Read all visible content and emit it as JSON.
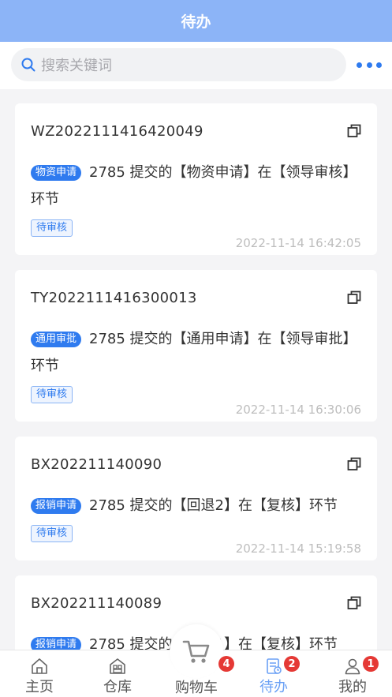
{
  "header": {
    "title": "待办"
  },
  "search": {
    "placeholder": "搜索关键词"
  },
  "cards": [
    {
      "code": "WZ2022111416420049",
      "type": "物资申请",
      "text": "2785 提交的【物资申请】在【领导审核】环节",
      "status": "待审核",
      "time": "2022-11-14 16:42:05"
    },
    {
      "code": "TY2022111416300013",
      "type": "通用审批",
      "text": "2785 提交的【通用申请】在【领导审批】环节",
      "status": "待审核",
      "time": "2022-11-14 16:30:06"
    },
    {
      "code": "BX202211140090",
      "type": "报销申请",
      "text": "2785 提交的【回退2】在【复核】环节",
      "status": "待审核",
      "time": "2022-11-14 15:19:58"
    },
    {
      "code": "BX202211140089",
      "type": "报销申请",
      "text": "2785 提交的【回退1】在【复核】环节",
      "status": "",
      "time": ""
    }
  ],
  "tabbar": {
    "tabs": [
      {
        "label": "主页",
        "icon": "home-icon",
        "badge": ""
      },
      {
        "label": "仓库",
        "icon": "warehouse-icon",
        "badge": ""
      },
      {
        "label": "购物车",
        "icon": "cart-icon",
        "badge": "4"
      },
      {
        "label": "待办",
        "icon": "todo-icon",
        "badge": "2",
        "active": true
      },
      {
        "label": "我的",
        "icon": "user-icon",
        "badge": "1"
      }
    ]
  },
  "colors": {
    "header": "#8cb4f7",
    "accent": "#2f7bef",
    "badge": "#e53935"
  }
}
